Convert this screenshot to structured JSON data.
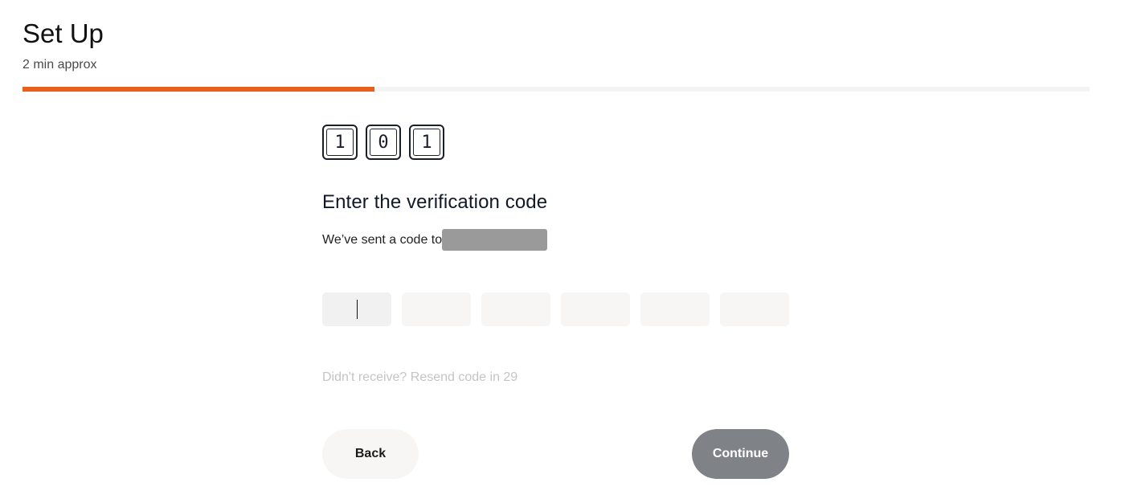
{
  "header": {
    "title": "Set Up",
    "subtitle": "2 min approx"
  },
  "progress": {
    "fraction": 0.33,
    "color": "#e8601c"
  },
  "code_icon": {
    "digits": [
      "1",
      "0",
      "1"
    ]
  },
  "main": {
    "heading": "Enter the verification code",
    "sent_text": "We’ve sent a code to",
    "otp_values": [
      "",
      "",
      "",
      "",
      "",
      ""
    ],
    "resend_text": "Didn't receive? Resend code in 29"
  },
  "buttons": {
    "back_label": "Back",
    "continue_label": "Continue"
  },
  "colors": {
    "accent": "#e8601c",
    "continue_disabled": "#7f8286",
    "back_bg": "#f8f6f4"
  }
}
